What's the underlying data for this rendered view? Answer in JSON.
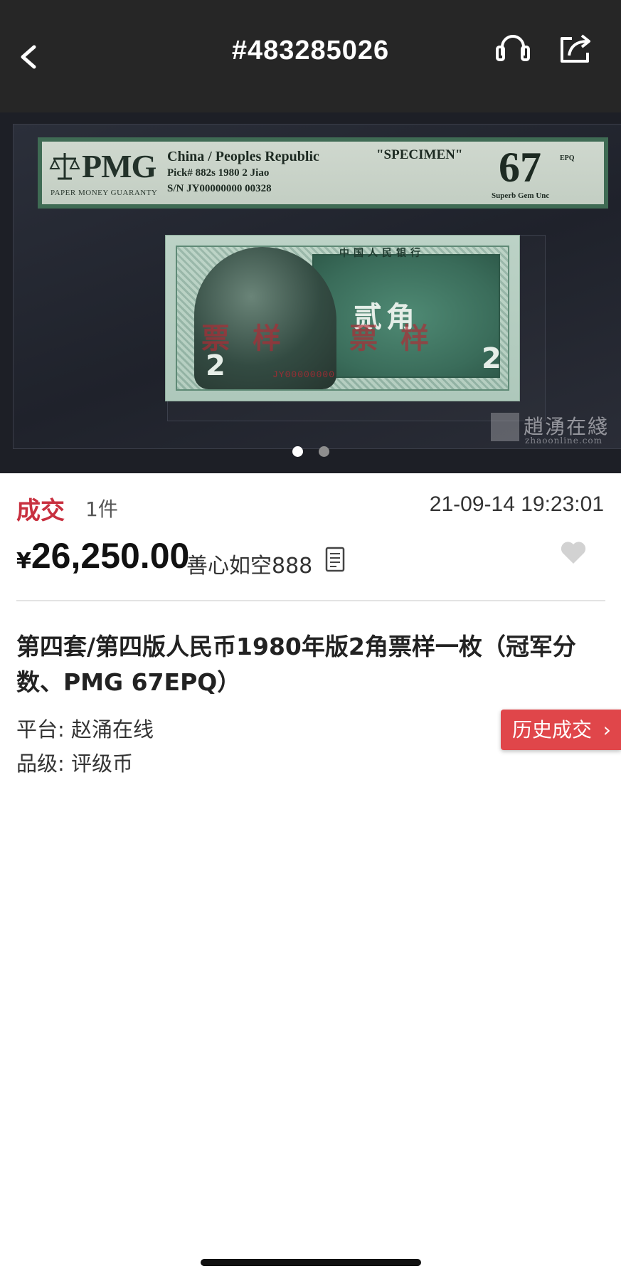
{
  "header": {
    "title": "#483285026",
    "back_icon": "chevron-left-icon",
    "service_icon": "headset-icon",
    "share_icon": "share-icon"
  },
  "carousel": {
    "page_count": 2,
    "active_index": 0,
    "label": {
      "brand": "PMG",
      "guaranty": "PAPER MONEY GUARANTY",
      "country": "China / Peoples Republic",
      "specimen": "\"SPECIMEN\"",
      "pick": "Pick# 882s  1980  2 Jiao",
      "serial": "S/N JY00000000 00328",
      "grade": "67",
      "grade_suffix": "EPQ",
      "grade_desc": "Superb Gem Unc"
    },
    "note": {
      "bank": "中国人民银行",
      "value": "贰角",
      "specimen_mark": "票样",
      "serial": "JY00000000",
      "denom": "2"
    },
    "watermark": {
      "name": "趙湧在綫",
      "url": "zhaoonline.com"
    }
  },
  "deal": {
    "status": "成交",
    "quantity": "1件",
    "time": "21-09-14 19:23:01",
    "currency": "¥",
    "price": "26,250.00",
    "seller": "善心如空888"
  },
  "item": {
    "title": "第四套/第四版人民币1980年版2角票样一枚（冠军分数、PMG 67EPQ）",
    "platform": "平台: 赵涌在线",
    "grade": "品级: 评级币",
    "history_button": "历史成交"
  },
  "colors": {
    "header_bg": "#262626",
    "accent_red": "#c8303f",
    "history_button_bg": "#e0464a"
  }
}
